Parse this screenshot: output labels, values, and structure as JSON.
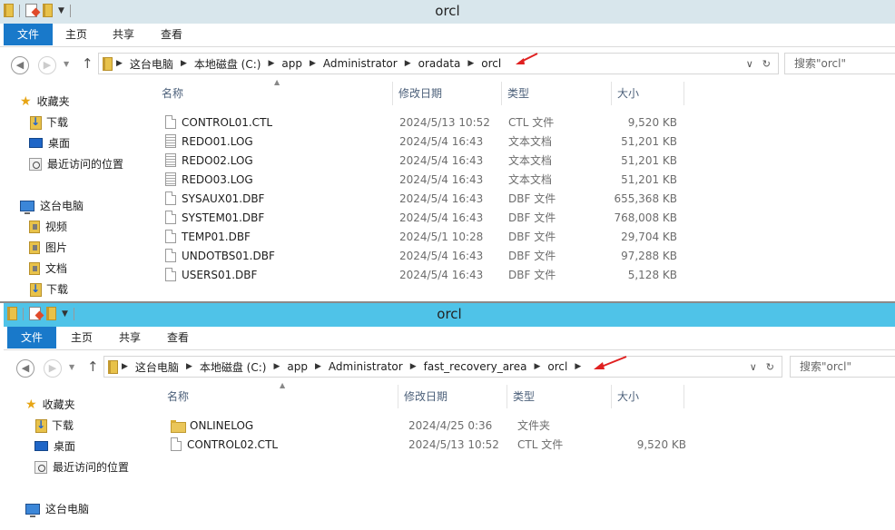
{
  "window1": {
    "title": "orcl",
    "ribbon": {
      "file": "文件",
      "home": "主页",
      "share": "共享",
      "view": "查看"
    },
    "breadcrumbs": [
      "这台电脑",
      "本地磁盘 (C:)",
      "app",
      "Administrator",
      "oradata",
      "orcl"
    ],
    "search_placeholder": "搜索\"orcl\"",
    "sidebar": {
      "favorites": "收藏夹",
      "downloads": "下载",
      "desktop": "桌面",
      "recent": "最近访问的位置",
      "this_pc": "这台电脑",
      "videos": "视频",
      "pictures": "图片",
      "documents": "文档",
      "downloads2": "下载"
    },
    "columns": {
      "name": "名称",
      "date": "修改日期",
      "type": "类型",
      "size": "大小"
    },
    "files": [
      {
        "name": "CONTROL01.CTL",
        "date": "2024/5/13 10:52",
        "type": "CTL 文件",
        "size": "9,520 KB",
        "icon": "file-icon"
      },
      {
        "name": "REDO01.LOG",
        "date": "2024/5/4 16:43",
        "type": "文本文档",
        "size": "51,201 KB",
        "icon": "text-file-icon"
      },
      {
        "name": "REDO02.LOG",
        "date": "2024/5/4 16:43",
        "type": "文本文档",
        "size": "51,201 KB",
        "icon": "text-file-icon"
      },
      {
        "name": "REDO03.LOG",
        "date": "2024/5/4 16:43",
        "type": "文本文档",
        "size": "51,201 KB",
        "icon": "text-file-icon"
      },
      {
        "name": "SYSAUX01.DBF",
        "date": "2024/5/4 16:43",
        "type": "DBF 文件",
        "size": "655,368 KB",
        "icon": "file-icon"
      },
      {
        "name": "SYSTEM01.DBF",
        "date": "2024/5/4 16:43",
        "type": "DBF 文件",
        "size": "768,008 KB",
        "icon": "file-icon"
      },
      {
        "name": "TEMP01.DBF",
        "date": "2024/5/1 10:28",
        "type": "DBF 文件",
        "size": "29,704 KB",
        "icon": "file-icon"
      },
      {
        "name": "UNDOTBS01.DBF",
        "date": "2024/5/4 16:43",
        "type": "DBF 文件",
        "size": "97,288 KB",
        "icon": "file-icon"
      },
      {
        "name": "USERS01.DBF",
        "date": "2024/5/4 16:43",
        "type": "DBF 文件",
        "size": "5,128 KB",
        "icon": "file-icon"
      }
    ]
  },
  "window2": {
    "title": "orcl",
    "ribbon": {
      "file": "文件",
      "home": "主页",
      "share": "共享",
      "view": "查看"
    },
    "breadcrumbs": [
      "这台电脑",
      "本地磁盘 (C:)",
      "app",
      "Administrator",
      "fast_recovery_area",
      "orcl"
    ],
    "search_placeholder": "搜索\"orcl\"",
    "sidebar": {
      "favorites": "收藏夹",
      "downloads": "下载",
      "desktop": "桌面",
      "recent": "最近访问的位置",
      "this_pc": "这台电脑"
    },
    "columns": {
      "name": "名称",
      "date": "修改日期",
      "type": "类型",
      "size": "大小"
    },
    "files": [
      {
        "name": "ONLINELOG",
        "date": "2024/4/25 0:36",
        "type": "文件夹",
        "size": "",
        "icon": "folder-icon"
      },
      {
        "name": "CONTROL02.CTL",
        "date": "2024/5/13 10:52",
        "type": "CTL 文件",
        "size": "9,520 KB",
        "icon": "file-icon"
      }
    ]
  },
  "colors": {
    "title_active": "#4fc3e8",
    "title_inactive": "#d8e6ec",
    "file_tab": "#1979ca",
    "annotation_arrow": "#e02020"
  }
}
